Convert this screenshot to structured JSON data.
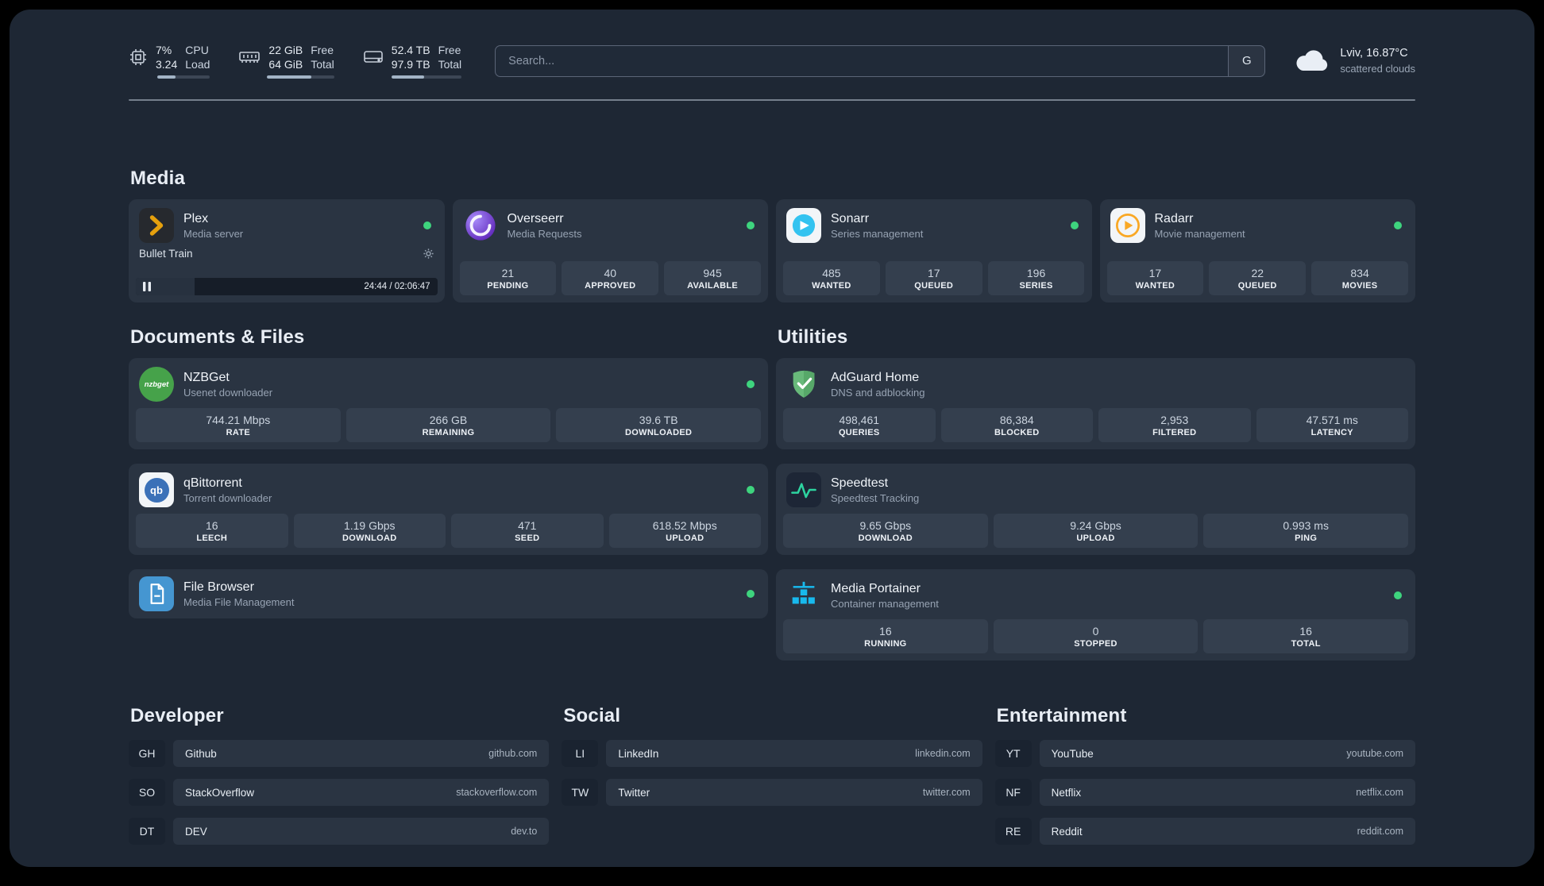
{
  "colors": {
    "background": "#1e2734",
    "card": "#2a3442",
    "stat_box": "#343f4e",
    "status_green": "#3ed47e",
    "plex_gold": "#e5a00d"
  },
  "topbar": {
    "cpu": {
      "value1": "7%",
      "value2": "3.24",
      "label1": "CPU",
      "label2": "Load",
      "bar_style": "width:34%"
    },
    "memory": {
      "value1": "22 GiB",
      "value2": "64 GiB",
      "label1": "Free",
      "label2": "Total",
      "bar_style": "width:66%"
    },
    "disk": {
      "value1": "52.4 TB",
      "value2": "97.9 TB",
      "label1": "Free",
      "label2": "Total",
      "bar_style": "width:47%"
    },
    "search": {
      "placeholder": "Search...",
      "button_label": "G"
    },
    "weather": {
      "location": "Lviv, 16.87°C",
      "condition": "scattered clouds"
    }
  },
  "sections": {
    "media": "Media",
    "documents": "Documents & Files",
    "utilities": "Utilities",
    "developer": "Developer",
    "social": "Social",
    "entertainment": "Entertainment"
  },
  "services": {
    "plex": {
      "name": "Plex",
      "subtitle": "Media server",
      "now_playing": {
        "title": "Bullet Train",
        "time": "24:44 / 02:06:47",
        "progress_style": "width:19.5%"
      }
    },
    "overseerr": {
      "name": "Overseerr",
      "subtitle": "Media Requests",
      "stats": [
        {
          "value": "21",
          "label": "PENDING"
        },
        {
          "value": "40",
          "label": "APPROVED"
        },
        {
          "value": "945",
          "label": "AVAILABLE"
        }
      ]
    },
    "sonarr": {
      "name": "Sonarr",
      "subtitle": "Series management",
      "stats": [
        {
          "value": "485",
          "label": "WANTED"
        },
        {
          "value": "17",
          "label": "QUEUED"
        },
        {
          "value": "196",
          "label": "SERIES"
        }
      ]
    },
    "radarr": {
      "name": "Radarr",
      "subtitle": "Movie management",
      "stats": [
        {
          "value": "17",
          "label": "WANTED"
        },
        {
          "value": "22",
          "label": "QUEUED"
        },
        {
          "value": "834",
          "label": "MOVIES"
        }
      ]
    },
    "nzbget": {
      "name": "NZBGet",
      "subtitle": "Usenet downloader",
      "icon_text": "nzbget",
      "stats": [
        {
          "value": "744.21 Mbps",
          "label": "RATE"
        },
        {
          "value": "266 GB",
          "label": "REMAINING"
        },
        {
          "value": "39.6 TB",
          "label": "DOWNLOADED"
        }
      ]
    },
    "qbittorrent": {
      "name": "qBittorrent",
      "subtitle": "Torrent downloader",
      "icon_text": "qb",
      "stats": [
        {
          "value": "16",
          "label": "LEECH"
        },
        {
          "value": "1.19 Gbps",
          "label": "DOWNLOAD"
        },
        {
          "value": "471",
          "label": "SEED"
        },
        {
          "value": "618.52 Mbps",
          "label": "UPLOAD"
        }
      ]
    },
    "filebrowser": {
      "name": "File Browser",
      "subtitle": "Media File Management"
    },
    "adguard": {
      "name": "AdGuard Home",
      "subtitle": "DNS and adblocking",
      "stats": [
        {
          "value": "498,461",
          "label": "QUERIES"
        },
        {
          "value": "86,384",
          "label": "BLOCKED"
        },
        {
          "value": "2,953",
          "label": "FILTERED"
        },
        {
          "value": "47.571 ms",
          "label": "LATENCY"
        }
      ]
    },
    "speedtest": {
      "name": "Speedtest",
      "subtitle": "Speedtest Tracking",
      "stats": [
        {
          "value": "9.65 Gbps",
          "label": "DOWNLOAD"
        },
        {
          "value": "9.24 Gbps",
          "label": "UPLOAD"
        },
        {
          "value": "0.993 ms",
          "label": "PING"
        }
      ]
    },
    "portainer": {
      "name": "Media Portainer",
      "subtitle": "Container management",
      "stats": [
        {
          "value": "16",
          "label": "RUNNING"
        },
        {
          "value": "0",
          "label": "STOPPED"
        },
        {
          "value": "16",
          "label": "TOTAL"
        }
      ]
    }
  },
  "bookmarks": {
    "developer": [
      {
        "abbr": "GH",
        "name": "Github",
        "domain": "github.com"
      },
      {
        "abbr": "SO",
        "name": "StackOverflow",
        "domain": "stackoverflow.com"
      },
      {
        "abbr": "DT",
        "name": "DEV",
        "domain": "dev.to"
      }
    ],
    "social": [
      {
        "abbr": "LI",
        "name": "LinkedIn",
        "domain": "linkedin.com"
      },
      {
        "abbr": "TW",
        "name": "Twitter",
        "domain": "twitter.com"
      }
    ],
    "entertainment": [
      {
        "abbr": "YT",
        "name": "YouTube",
        "domain": "youtube.com"
      },
      {
        "abbr": "NF",
        "name": "Netflix",
        "domain": "netflix.com"
      },
      {
        "abbr": "RE",
        "name": "Reddit",
        "domain": "reddit.com"
      }
    ]
  }
}
